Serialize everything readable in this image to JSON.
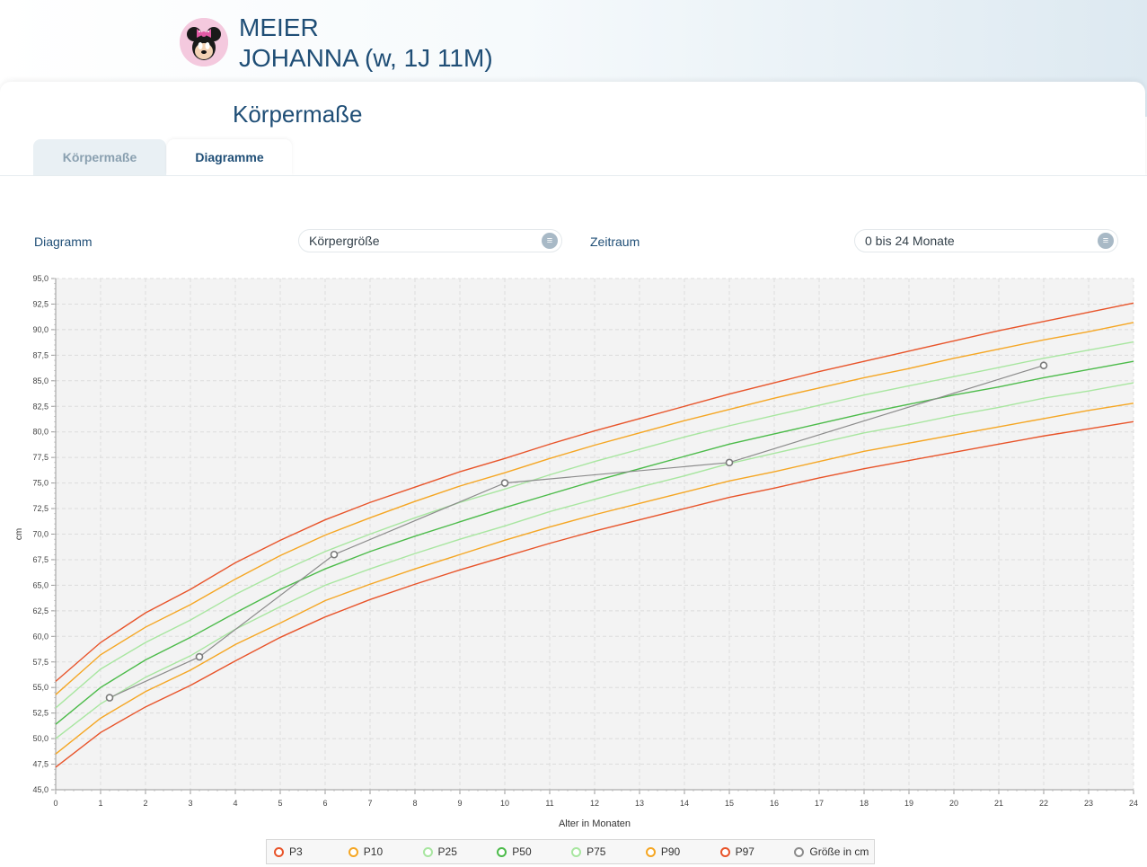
{
  "patient": {
    "name_line1": "MEIER",
    "name_line2": "JOHANNA (w, 1J 11M)"
  },
  "page": {
    "title": "Körpermaße",
    "tabs": [
      {
        "label": "Körpermaße",
        "active": false
      },
      {
        "label": "Diagramme",
        "active": true
      }
    ]
  },
  "controls": {
    "diagram_label": "Diagramm",
    "diagram_value": "Körpergröße",
    "period_label": "Zeitraum",
    "period_value": "0 bis 24 Monate"
  },
  "colors": {
    "P3": "#e8542a",
    "P10": "#f5a623",
    "P25": "#a8e6a0",
    "P50": "#4cbb4a",
    "P75": "#a8e6a0",
    "P90": "#f5a623",
    "P97": "#e8542a",
    "patient": "#8c8c8c"
  },
  "chart_data": {
    "type": "line",
    "xlabel": "Alter in Monaten",
    "ylabel": "cm",
    "xlim": [
      0,
      24
    ],
    "ylim": [
      45,
      95
    ],
    "x_ticks": [
      0,
      1,
      2,
      3,
      4,
      5,
      6,
      7,
      8,
      9,
      10,
      11,
      12,
      13,
      14,
      15,
      16,
      17,
      18,
      19,
      20,
      21,
      22,
      23,
      24
    ],
    "y_ticks": [
      "45,0",
      "47,5",
      "50,0",
      "52,5",
      "55,0",
      "57,5",
      "60,0",
      "62,5",
      "65,0",
      "67,5",
      "70,0",
      "72,5",
      "75,0",
      "77,5",
      "80,0",
      "82,5",
      "85,0",
      "87,5",
      "90,0",
      "92,5",
      "95,0"
    ],
    "grid": true,
    "legend_position": "bottom",
    "x": [
      0,
      1,
      2,
      3,
      4,
      5,
      6,
      7,
      8,
      9,
      10,
      11,
      12,
      13,
      14,
      15,
      16,
      17,
      18,
      19,
      20,
      21,
      22,
      23,
      24
    ],
    "series": [
      {
        "name": "P3",
        "color_key": "P3",
        "values": [
          47.2,
          50.6,
          53.1,
          55.2,
          57.6,
          59.9,
          61.9,
          63.6,
          65.1,
          66.5,
          67.8,
          69.1,
          70.3,
          71.4,
          72.5,
          73.6,
          74.5,
          75.5,
          76.4,
          77.2,
          78.0,
          78.8,
          79.6,
          80.3,
          81.0
        ]
      },
      {
        "name": "P10",
        "color_key": "P10",
        "values": [
          48.5,
          52.0,
          54.6,
          56.7,
          59.2,
          61.3,
          63.5,
          65.1,
          66.6,
          68.0,
          69.4,
          70.7,
          71.9,
          73.0,
          74.1,
          75.2,
          76.1,
          77.1,
          78.1,
          78.9,
          79.7,
          80.5,
          81.3,
          82.1,
          82.8
        ]
      },
      {
        "name": "P25",
        "color_key": "P25",
        "values": [
          50.0,
          53.4,
          56.0,
          58.1,
          60.7,
          62.9,
          65.0,
          66.6,
          68.1,
          69.5,
          70.8,
          72.2,
          73.4,
          74.6,
          75.7,
          76.9,
          77.9,
          78.9,
          79.9,
          80.7,
          81.6,
          82.4,
          83.3,
          84.0,
          84.8
        ]
      },
      {
        "name": "P50",
        "color_key": "P50",
        "values": [
          51.4,
          55.0,
          57.7,
          59.9,
          62.3,
          64.6,
          66.6,
          68.3,
          69.8,
          71.2,
          72.6,
          73.9,
          75.2,
          76.4,
          77.6,
          78.8,
          79.8,
          80.8,
          81.8,
          82.7,
          83.6,
          84.4,
          85.3,
          86.1,
          86.9
        ]
      },
      {
        "name": "P75",
        "color_key": "P75",
        "values": [
          53.0,
          56.8,
          59.4,
          61.6,
          64.1,
          66.3,
          68.3,
          70.0,
          71.6,
          73.1,
          74.4,
          75.8,
          77.1,
          78.3,
          79.5,
          80.6,
          81.6,
          82.6,
          83.6,
          84.5,
          85.4,
          86.3,
          87.2,
          88.0,
          88.8
        ]
      },
      {
        "name": "P90",
        "color_key": "P90",
        "values": [
          54.3,
          58.2,
          60.9,
          63.1,
          65.6,
          67.9,
          69.9,
          71.6,
          73.2,
          74.7,
          76.0,
          77.4,
          78.7,
          79.9,
          81.1,
          82.2,
          83.3,
          84.3,
          85.3,
          86.2,
          87.2,
          88.1,
          89.0,
          89.8,
          90.7
        ]
      },
      {
        "name": "P97",
        "color_key": "P97",
        "values": [
          55.6,
          59.4,
          62.3,
          64.6,
          67.2,
          69.4,
          71.4,
          73.1,
          74.6,
          76.1,
          77.4,
          78.8,
          80.1,
          81.3,
          82.5,
          83.7,
          84.8,
          85.9,
          86.9,
          87.9,
          88.9,
          89.9,
          90.8,
          91.7,
          92.6
        ]
      }
    ],
    "patient_series": {
      "name": "Größe in cm",
      "color_key": "patient",
      "points": [
        {
          "x": 1.2,
          "y": 54.0
        },
        {
          "x": 3.2,
          "y": 58.0
        },
        {
          "x": 6.2,
          "y": 68.0
        },
        {
          "x": 10.0,
          "y": 75.0
        },
        {
          "x": 15.0,
          "y": 77.0
        },
        {
          "x": 22.0,
          "y": 86.5
        }
      ]
    }
  },
  "legend": [
    {
      "label": "P3",
      "color_key": "P3"
    },
    {
      "label": "P10",
      "color_key": "P10"
    },
    {
      "label": "P25",
      "color_key": "P25"
    },
    {
      "label": "P50",
      "color_key": "P50"
    },
    {
      "label": "P75",
      "color_key": "P75"
    },
    {
      "label": "P90",
      "color_key": "P90"
    },
    {
      "label": "P97",
      "color_key": "P97"
    },
    {
      "label": "Größe in cm",
      "color_key": "patient"
    }
  ]
}
